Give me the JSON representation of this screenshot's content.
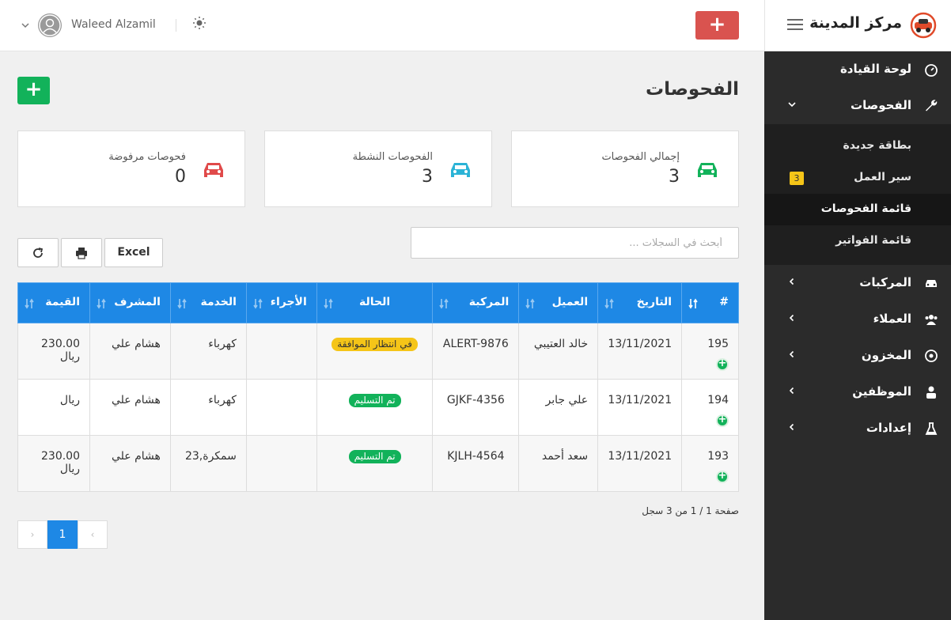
{
  "brand": {
    "name": "مركز المدينة"
  },
  "topbar": {
    "add_label": "+",
    "user_name": "Waleed Alzamil"
  },
  "sidebar": {
    "items": [
      {
        "label": "لوحة القيادة",
        "icon": "dashboard-icon"
      },
      {
        "label": "الفحوصات",
        "icon": "wrench-icon",
        "expanded": true
      },
      {
        "label": "المركبات",
        "icon": "car-icon"
      },
      {
        "label": "العملاء",
        "icon": "users-icon"
      },
      {
        "label": "المخزون",
        "icon": "box-icon"
      },
      {
        "label": "الموظفين",
        "icon": "user-icon"
      },
      {
        "label": "إعدادات",
        "icon": "flask-icon"
      }
    ],
    "submenu": [
      {
        "label": "بطاقة جديدة"
      },
      {
        "label": "سير العمل",
        "badge": "3"
      },
      {
        "label": "قائمة الفحوصات",
        "active": true
      },
      {
        "label": "قائمة الفواتير"
      }
    ]
  },
  "page": {
    "title": "الفحوصات",
    "add_label": "+"
  },
  "stats": [
    {
      "label": "إجمالي الفحوصات",
      "value": "3",
      "color": "#12b25a"
    },
    {
      "label": "الفحوصات النشطة",
      "value": "3",
      "color": "#2bb3d6"
    },
    {
      "label": "فحوصات مرفوضة",
      "value": "0",
      "color": "#e04a4a"
    }
  ],
  "toolbar": {
    "search_placeholder": "أبحث في السجلات ...",
    "excel_label": "Excel"
  },
  "table": {
    "columns": [
      "#",
      "التاريخ",
      "العميل",
      "المركبة",
      "الحالة",
      "الأجراء",
      "الخدمة",
      "المشرف",
      "القيمة"
    ],
    "rows": [
      {
        "id": "195",
        "date": "13/11/2021",
        "client": "خالد العتيبي",
        "vehicle": "ALERT-9876",
        "status": "في انتظار الموافقة",
        "status_type": "pending",
        "action": "",
        "service": "كهرباء",
        "supervisor": "هشام علي",
        "value": "230.00 ريال"
      },
      {
        "id": "194",
        "date": "13/11/2021",
        "client": "علي جابر",
        "vehicle": "GJKF-4356",
        "status": "تم التسليم",
        "status_type": "done",
        "action": "",
        "service": "كهرباء",
        "supervisor": "هشام علي",
        "value": "ريال"
      },
      {
        "id": "193",
        "date": "13/11/2021",
        "client": "سعد أحمد",
        "vehicle": "KJLH-4564",
        "status": "تم التسليم",
        "status_type": "done",
        "action": "",
        "service": "سمكرة,23",
        "supervisor": "هشام علي",
        "value": "230.00 ريال"
      }
    ]
  },
  "pagination": {
    "info": "صفحة 1 / 1 من 3 سجل",
    "current": "1",
    "prev": "‹",
    "next": "›"
  },
  "colors": {
    "primary": "#1e88e5",
    "success": "#12b25a",
    "danger": "#d9534f",
    "sidebar": "#2b2b2b",
    "badge": "#f5c518"
  }
}
